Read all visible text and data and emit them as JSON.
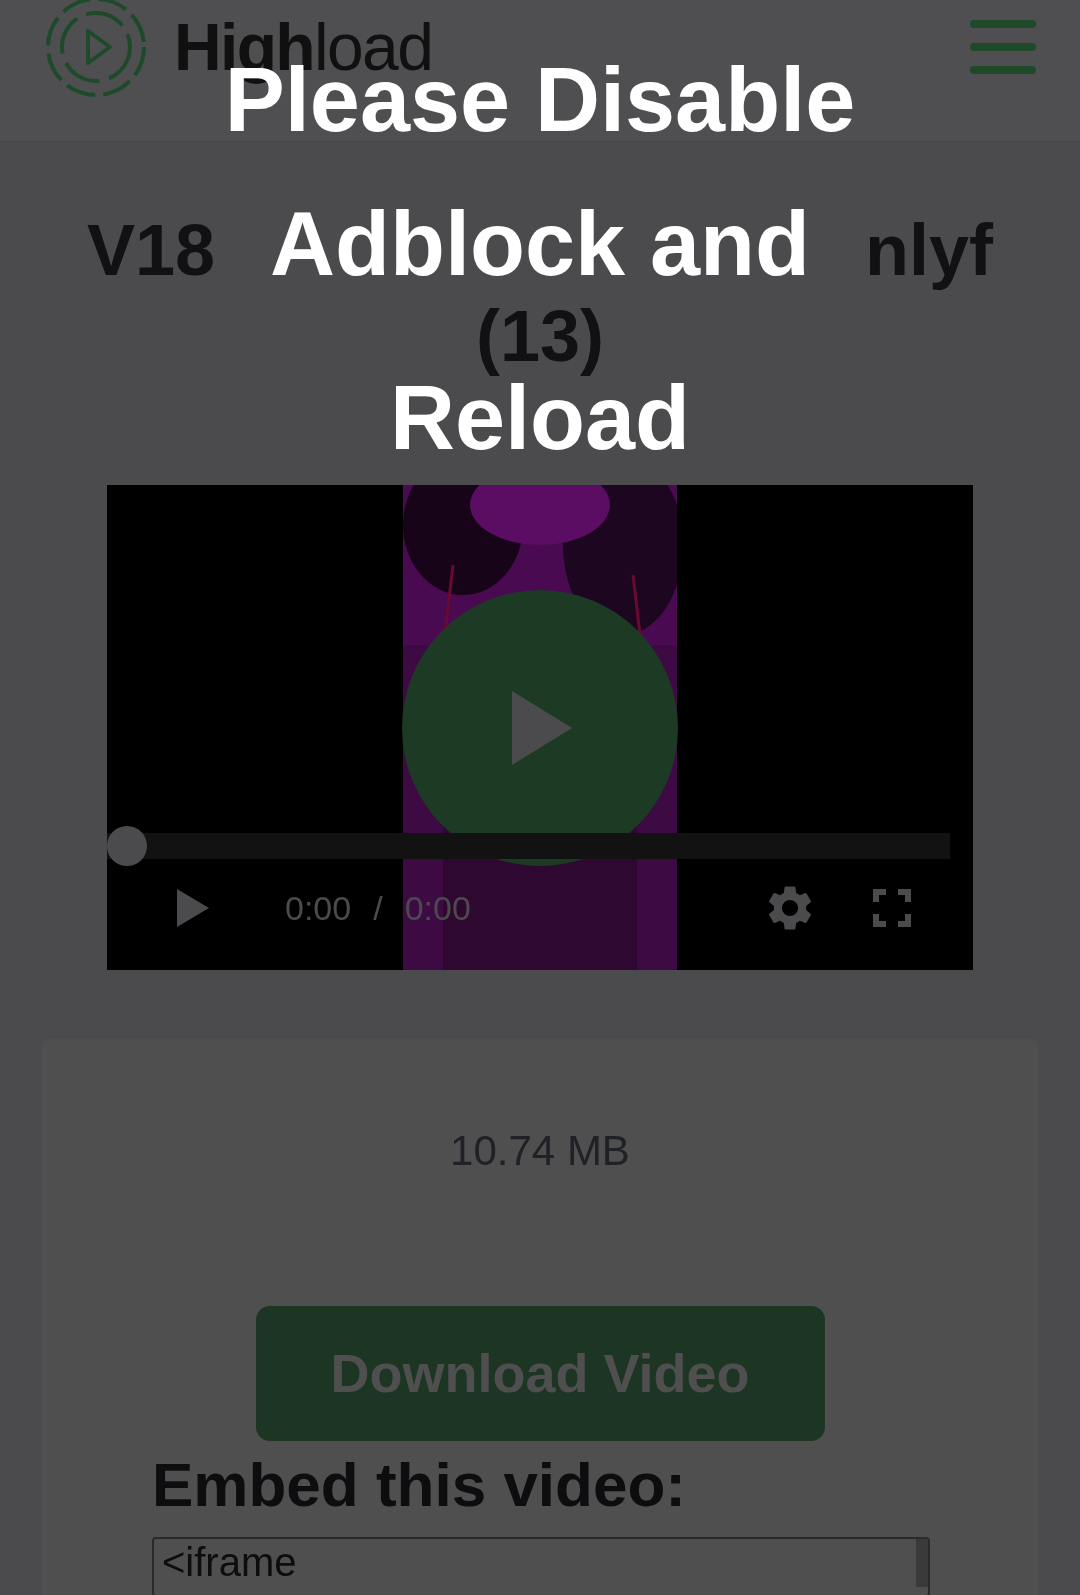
{
  "header": {
    "logo_text": "**High**load"
  },
  "title": {
    "line_1_left": "V18",
    "line_1_right": "nlyf",
    "line_2": "(13)"
  },
  "video": {
    "kind": "picture",
    "progress": {
      "level": 0
    },
    "current_time": "0:00",
    "separator": "/",
    "duration": "0:00"
  },
  "file_size": "10.74 MB",
  "download_button": "Download Video",
  "embed": {
    "heading": "Embed this video:",
    "value": "<iframe"
  },
  "overlay": {
    "message_lines": [
      "Please Disable",
      "Adblock and",
      "Reload"
    ]
  }
}
